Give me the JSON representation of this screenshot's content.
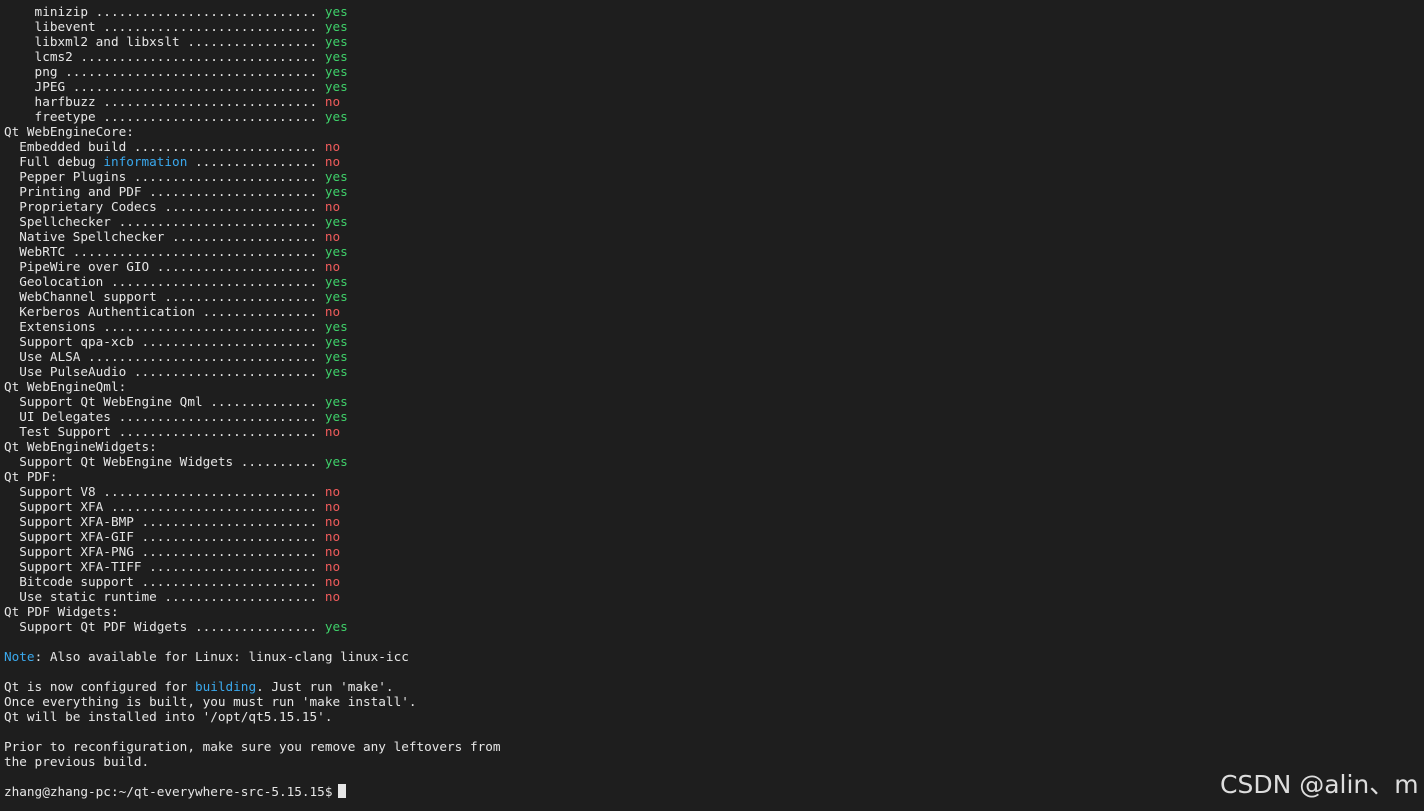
{
  "colors": {
    "background": "#1e1e1e",
    "text": "#e6e6e6",
    "yes": "#3fd06a",
    "no": "#ef5b5b",
    "keyword": "#3aa8ec"
  },
  "lines": [
    {
      "label": "    minizip",
      "dots": " ............................. ",
      "value": "yes"
    },
    {
      "label": "    libevent",
      "dots": " ............................ ",
      "value": "yes"
    },
    {
      "label": "    libxml2 and libxslt",
      "dots": " ................. ",
      "value": "yes"
    },
    {
      "label": "    lcms2",
      "dots": " ............................... ",
      "value": "yes"
    },
    {
      "label": "    png",
      "dots": " ................................. ",
      "value": "yes"
    },
    {
      "label": "    JPEG",
      "dots": " ................................ ",
      "value": "yes"
    },
    {
      "label": "    harfbuzz",
      "dots": " ............................ ",
      "value": "no"
    },
    {
      "label": "    freetype",
      "dots": " ............................ ",
      "value": "yes"
    },
    {
      "heading": "Qt WebEngineCore:"
    },
    {
      "label": "  Embedded build",
      "dots": " ........................ ",
      "value": "no"
    },
    {
      "label_pre": "  Full debug ",
      "label_kw": "information",
      "dots": " ................ ",
      "value": "no"
    },
    {
      "label": "  Pepper Plugins",
      "dots": " ........................ ",
      "value": "yes"
    },
    {
      "label": "  Printing and PDF",
      "dots": " ...................... ",
      "value": "yes"
    },
    {
      "label": "  Proprietary Codecs",
      "dots": " .................... ",
      "value": "no"
    },
    {
      "label": "  Spellchecker",
      "dots": " .......................... ",
      "value": "yes"
    },
    {
      "label": "  Native Spellchecker",
      "dots": " ................... ",
      "value": "no"
    },
    {
      "label": "  WebRTC",
      "dots": " ................................ ",
      "value": "yes"
    },
    {
      "label": "  PipeWire over GIO",
      "dots": " ..................... ",
      "value": "no"
    },
    {
      "label": "  Geolocation",
      "dots": " ........................... ",
      "value": "yes"
    },
    {
      "label": "  WebChannel support",
      "dots": " .................... ",
      "value": "yes"
    },
    {
      "label": "  Kerberos Authentication",
      "dots": " ............... ",
      "value": "no"
    },
    {
      "label": "  Extensions",
      "dots": " ............................ ",
      "value": "yes"
    },
    {
      "label": "  Support qpa-xcb",
      "dots": " ....................... ",
      "value": "yes"
    },
    {
      "label": "  Use ALSA",
      "dots": " .............................. ",
      "value": "yes"
    },
    {
      "label": "  Use PulseAudio",
      "dots": " ........................ ",
      "value": "yes"
    },
    {
      "heading": "Qt WebEngineQml:"
    },
    {
      "label": "  Support Qt WebEngine Qml",
      "dots": " .............. ",
      "value": "yes"
    },
    {
      "label": "  UI Delegates",
      "dots": " .......................... ",
      "value": "yes"
    },
    {
      "label": "  Test Support",
      "dots": " .......................... ",
      "value": "no"
    },
    {
      "heading": "Qt WebEngineWidgets:"
    },
    {
      "label": "  Support Qt WebEngine Widgets",
      "dots": " .......... ",
      "value": "yes"
    },
    {
      "heading": "Qt PDF:"
    },
    {
      "label": "  Support V8",
      "dots": " ............................ ",
      "value": "no"
    },
    {
      "label": "  Support XFA",
      "dots": " ........................... ",
      "value": "no"
    },
    {
      "label": "  Support XFA-BMP",
      "dots": " ....................... ",
      "value": "no"
    },
    {
      "label": "  Support XFA-GIF",
      "dots": " ....................... ",
      "value": "no"
    },
    {
      "label": "  Support XFA-PNG",
      "dots": " ....................... ",
      "value": "no"
    },
    {
      "label": "  Support XFA-TIFF",
      "dots": " ...................... ",
      "value": "no"
    },
    {
      "label": "  Bitcode support",
      "dots": " ....................... ",
      "value": "no"
    },
    {
      "label": "  Use static runtime",
      "dots": " .................... ",
      "value": "no"
    },
    {
      "heading": "Qt PDF Widgets:"
    },
    {
      "label": "  Support Qt PDF Widgets",
      "dots": " ................ ",
      "value": "yes"
    }
  ],
  "note": {
    "prefix": "Note",
    "text": ": Also available for Linux: linux-clang linux-icc"
  },
  "configured": {
    "line1_pre": "Qt is now configured for ",
    "line1_kw": "building",
    "line1_post": ". Just run 'make'.",
    "line2": "Once everything is built, you must run 'make install'.",
    "line3": "Qt will be installed into '/opt/qt5.15.15'."
  },
  "reconfig": {
    "line1": "Prior to reconfiguration, make sure you remove any leftovers from",
    "line2": "the previous build."
  },
  "prompt": "zhang@zhang-pc:~/qt-everywhere-src-5.15.15$",
  "watermark": "CSDN @alin、mi"
}
